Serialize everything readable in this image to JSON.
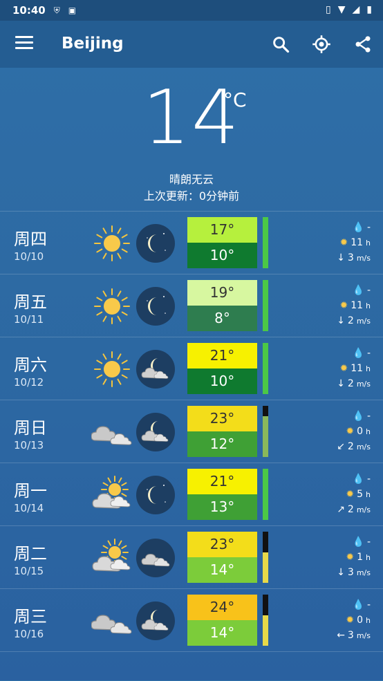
{
  "status": {
    "time": "10:40"
  },
  "app": {
    "title": "Beijing"
  },
  "current": {
    "temp": "14",
    "unit": "°C",
    "condition": "晴朗无云",
    "updated": "上次更新：0分钟前"
  },
  "colors": {
    "appbar": "#245d92",
    "statusbar": "#1e4e7c"
  },
  "days": [
    {
      "day": "周四",
      "date": "10/10",
      "day_icon": "sun-icon",
      "night_icon": "moon-icon",
      "high": "17°",
      "low": "10°",
      "high_color": "#b6f03d",
      "low_color": "#0f7a2f",
      "bar_color": "#4cc846",
      "bar_fraction": 1.0,
      "rain": "-",
      "sun": "11",
      "sun_unit": "h",
      "wind": "3",
      "wind_unit": "m/s",
      "wind_dir": "down"
    },
    {
      "day": "周五",
      "date": "10/11",
      "day_icon": "sun-icon",
      "night_icon": "moon-icon",
      "high": "19°",
      "low": "8°",
      "high_color": "#d7f7a0",
      "low_color": "#2e7d4f",
      "bar_color": "#4cc846",
      "bar_fraction": 1.0,
      "rain": "-",
      "sun": "11",
      "sun_unit": "h",
      "wind": "2",
      "wind_unit": "m/s",
      "wind_dir": "down"
    },
    {
      "day": "周六",
      "date": "10/12",
      "day_icon": "sun-icon",
      "night_icon": "cloudy-moon-icon",
      "high": "21°",
      "low": "10°",
      "high_color": "#f7f100",
      "low_color": "#0f7a2f",
      "bar_color": "#4cc846",
      "bar_fraction": 1.0,
      "rain": "-",
      "sun": "11",
      "sun_unit": "h",
      "wind": "2",
      "wind_unit": "m/s",
      "wind_dir": "down"
    },
    {
      "day": "周日",
      "date": "10/13",
      "day_icon": "cloud-icon",
      "night_icon": "cloudy-moon-icon",
      "high": "23°",
      "low": "12°",
      "high_color": "#f3dd1a",
      "low_color": "#3fa035",
      "bar_color": "#8ab85a",
      "bar_fraction": 0.8,
      "rain": "-",
      "sun": "0",
      "sun_unit": "h",
      "wind": "2",
      "wind_unit": "m/s",
      "wind_dir": "down-left"
    },
    {
      "day": "周一",
      "date": "10/14",
      "day_icon": "partly-cloudy-sun-icon",
      "night_icon": "moon-icon",
      "high": "21°",
      "low": "13°",
      "high_color": "#f7f100",
      "low_color": "#3fa035",
      "bar_color": "#4cc846",
      "bar_fraction": 1.0,
      "rain": "-",
      "sun": "5",
      "sun_unit": "h",
      "wind": "2",
      "wind_unit": "m/s",
      "wind_dir": "up-right"
    },
    {
      "day": "周二",
      "date": "10/15",
      "day_icon": "partly-cloudy-sun-icon",
      "night_icon": "cloud-icon",
      "high": "23°",
      "low": "14°",
      "high_color": "#f3dd1a",
      "low_color": "#7ccc3a",
      "bar_color": "#e7d949",
      "bar_fraction": 0.6,
      "rain": "-",
      "sun": "1",
      "sun_unit": "h",
      "wind": "3",
      "wind_unit": "m/s",
      "wind_dir": "down"
    },
    {
      "day": "周三",
      "date": "10/16",
      "day_icon": "cloud-icon",
      "night_icon": "cloudy-moon-icon",
      "high": "24°",
      "low": "14°",
      "high_color": "#f8c21a",
      "low_color": "#7ccc3a",
      "bar_color": "#e7d949",
      "bar_fraction": 0.6,
      "rain": "-",
      "sun": "0",
      "sun_unit": "h",
      "wind": "3",
      "wind_unit": "m/s",
      "wind_dir": "left"
    }
  ]
}
